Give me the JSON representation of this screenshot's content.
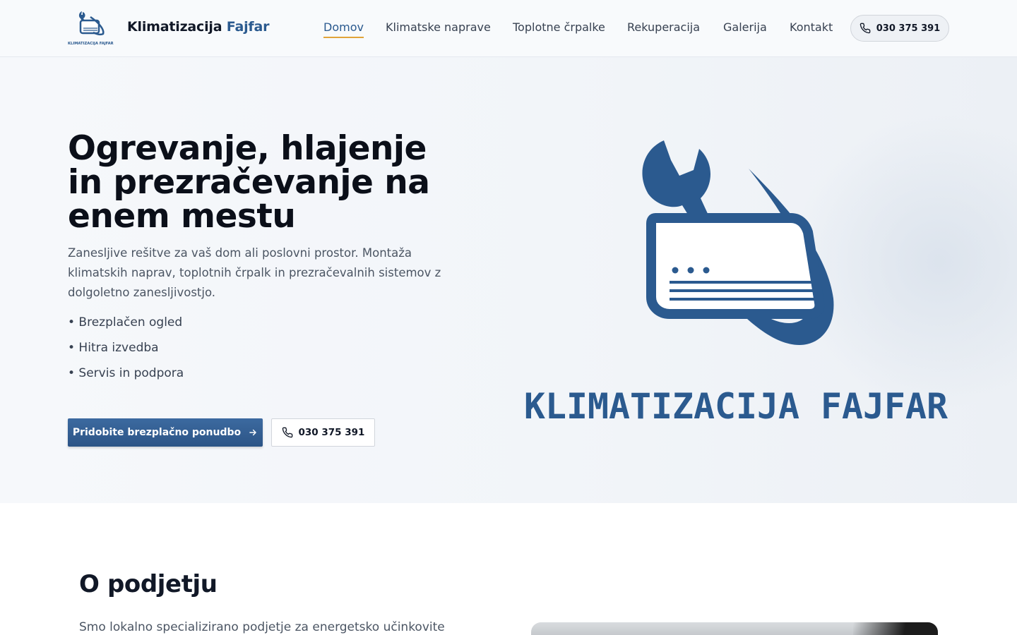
{
  "header": {
    "brand_main": "Klimatizacija ",
    "brand_accent": "Fajfar",
    "logo_caption": "KLIMATIZACIJA FAJFAR",
    "nav": [
      {
        "label": "Domov",
        "active": true
      },
      {
        "label": "Klimatske naprave",
        "active": false
      },
      {
        "label": "Toplotne črpalke",
        "active": false
      },
      {
        "label": "Rekuperacija",
        "active": false
      },
      {
        "label": "Galerija",
        "active": false
      },
      {
        "label": "Kontakt",
        "active": false
      }
    ],
    "phone": "030 375 391",
    "phone_icon": "phone-icon"
  },
  "hero": {
    "title_line1": "Ogrevanje, hlajenje",
    "title_line2": "in prezračevanje na",
    "title_line3": "enem mestu",
    "description": "Zanesljive rešitve za vaš dom ali poslovni prostor. Montaža klimatskih naprav, toplotnih črpalk in prezračevalnih sistemov z dolgoletno zanesljivostjo.",
    "bullets": [
      "• Brezplačen ogled",
      "• Hitra izvedba",
      "• Servis in podpora"
    ],
    "cta_primary": "Pridobite brezplačno ponudbo",
    "cta_primary_icon": "arrow-right-icon",
    "cta_secondary": "030 375 391",
    "cta_secondary_icon": "phone-icon",
    "wordmark": "KLIMATIZACIJA FAJFAR"
  },
  "about": {
    "title": "O podjetju",
    "text": "Smo lokalno specializirano podjetje za energetsko učinkovite"
  },
  "colors": {
    "brand_blue": "#2b5a8f",
    "nav_underline": "#e1a43a",
    "button_primary": "#33608f",
    "text_dark": "#0b0f19"
  }
}
